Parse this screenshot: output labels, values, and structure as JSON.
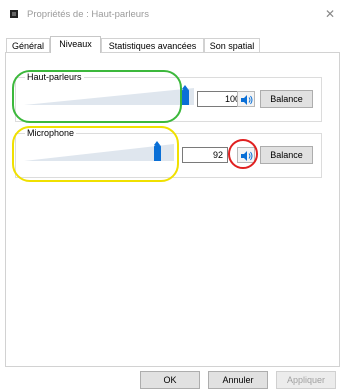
{
  "window": {
    "title": "Propriétés de : Haut-parleurs",
    "close_glyph": "✕"
  },
  "tabs": [
    {
      "label": "Général",
      "active": false
    },
    {
      "label": "Niveaux",
      "active": true
    },
    {
      "label": "Statistiques avancées",
      "active": false
    },
    {
      "label": "Son spatial",
      "active": false
    }
  ],
  "levels": {
    "speakers": {
      "label": "Haut-parleurs",
      "value": "100",
      "level_percent": 100,
      "balance_label": "Balance",
      "icon": "speaker-icon"
    },
    "microphone": {
      "label": "Microphone",
      "value": "92",
      "level_percent": 92,
      "balance_label": "Balance",
      "icon": "speaker-icon"
    }
  },
  "annotations": {
    "speakers_color": "#3cb83c",
    "microphone_color": "#f0e000",
    "mute_highlight_color": "#e02020"
  },
  "footer": {
    "ok_label": "OK",
    "cancel_label": "Annuler",
    "apply_label": "Appliquer"
  },
  "colors": {
    "accent": "#0a6fd6"
  }
}
